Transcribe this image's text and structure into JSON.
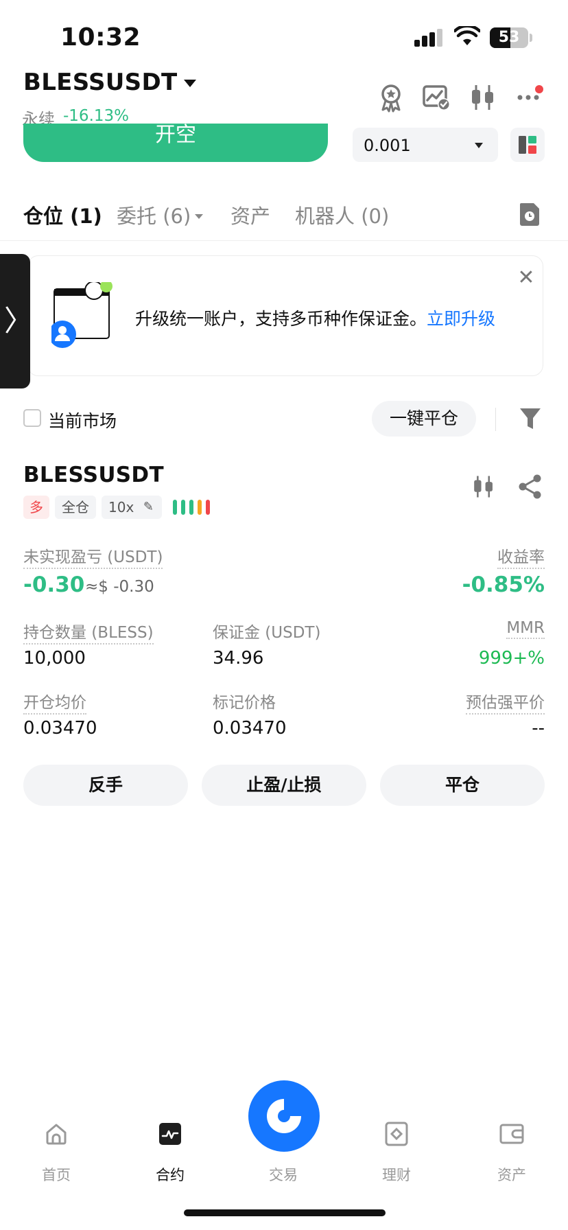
{
  "status": {
    "time": "10:32",
    "battery": "53",
    "battery_level": 0.53
  },
  "header": {
    "pair": "BLESSUSDT",
    "type_label": "永续",
    "change": "-16.13%",
    "icons": [
      "award-icon",
      "chart-check-icon",
      "candlestick-icon",
      "more-icon"
    ]
  },
  "trade_bar": {
    "open_short_label": "开空",
    "quantity_value": "0.001"
  },
  "tabs": [
    {
      "label": "仓位 (1)"
    },
    {
      "label": "委托 (6)"
    },
    {
      "label": "资产"
    },
    {
      "label": "机器人 (0)"
    }
  ],
  "banner": {
    "text": "升级统一账户，支持多币种作保证金。",
    "link": "立即升级"
  },
  "filter": {
    "current_market_label": "当前市场",
    "close_all_label": "一键平仓"
  },
  "position": {
    "symbol": "BLESSUSDT",
    "side_tag": "多",
    "margin_mode_tag": "全仓",
    "leverage_tag": "10x",
    "unrealized_pnl_label": "未实现盈亏 (USDT)",
    "unrealized_pnl_value": "-0.30",
    "unrealized_pnl_approx": "≈$ -0.30",
    "roe_label": "收益率",
    "roe_value": "-0.85%",
    "size_label": "持仓数量 (BLESS)",
    "size_value": "10,000",
    "margin_label": "保证金 (USDT)",
    "margin_value": "34.96",
    "mmr_label": "MMR",
    "mmr_value": "999+%",
    "entry_price_label": "开仓均价",
    "entry_price_value": "0.03470",
    "mark_price_label": "标记价格",
    "mark_price_value": "0.03470",
    "liq_price_label": "预估强平价",
    "liq_price_value": "--",
    "risk_colors": [
      "#2ebd85",
      "#2ebd85",
      "#2ebd85",
      "#f5a623",
      "#f0464a"
    ]
  },
  "actions": {
    "reverse": "反手",
    "tpsl": "止盈/止损",
    "close": "平仓"
  },
  "nav": {
    "home": "首页",
    "futures": "合约",
    "trade": "交易",
    "earn": "理财",
    "assets": "资产"
  },
  "colors": {
    "green": "#2ebd85",
    "red": "#f0464a",
    "blue": "#1677ff"
  }
}
